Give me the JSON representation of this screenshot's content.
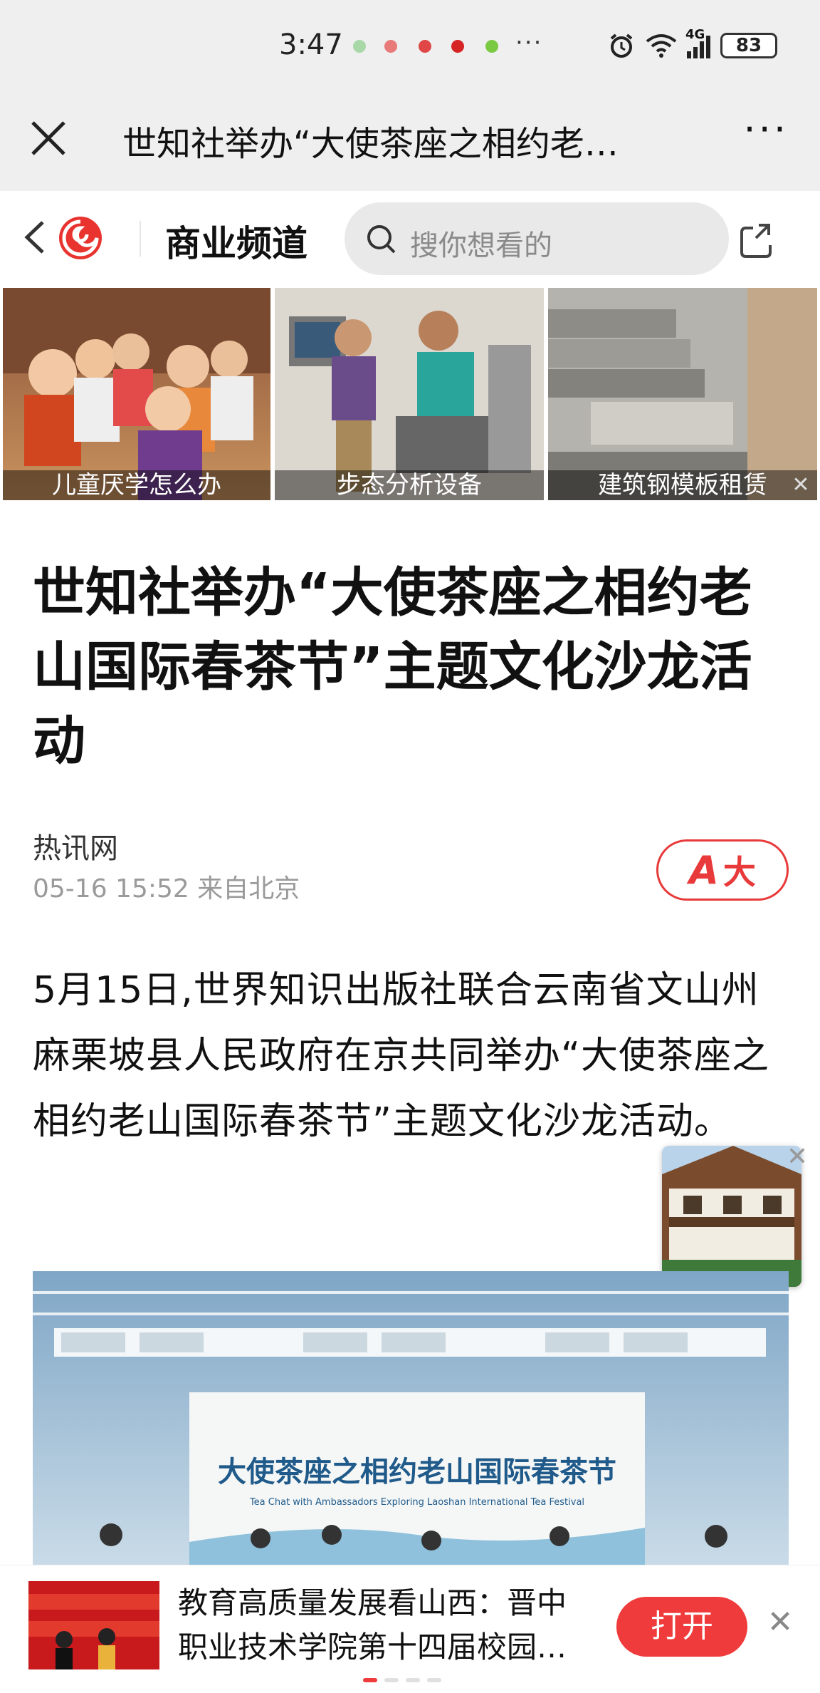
{
  "status_bar": {
    "time": "3:47",
    "overflow": "···",
    "battery": "83",
    "network": "4G",
    "icons": [
      "alarm-icon",
      "wifi-icon",
      "signal-icon",
      "battery-icon"
    ]
  },
  "title_bar": {
    "title": "世知社举办“大使茶座之相约老…",
    "close_icon": "close-icon",
    "more": "···"
  },
  "channel_bar": {
    "channel_name": "商业频道",
    "search_placeholder": "搜你想看的"
  },
  "ads": [
    {
      "caption": "儿童厌学怎么办"
    },
    {
      "caption": "步态分析设备"
    },
    {
      "caption": "建筑钢模板租赁"
    }
  ],
  "article": {
    "headline": "世知社举办“大使茶座之相约老山国际春茶节”主题文化沙龙活动",
    "source": "热讯网",
    "meta": "05-16 15:52 来自北京",
    "font_button_a": "A",
    "font_button_label": "大",
    "body": "5月15日,世界知识出版社联合云南省文山州麻栗坡县人民政府在京共同举办“大使茶座之相约老山国际春茶节”主题文化沙龙活动。",
    "banner_title": "大使茶座之相约老山国际春茶节",
    "banner_subtitle": "Tea Chat with Ambassadors Exploring Laoshan International Tea Festival"
  },
  "bottom_bar": {
    "title": "教育高质量发展看山西：晋中职业技术学院第十四届校园…",
    "open_label": "打开"
  },
  "colors": {
    "accent": "#ef3b3b",
    "status_bg": "#efefef"
  }
}
